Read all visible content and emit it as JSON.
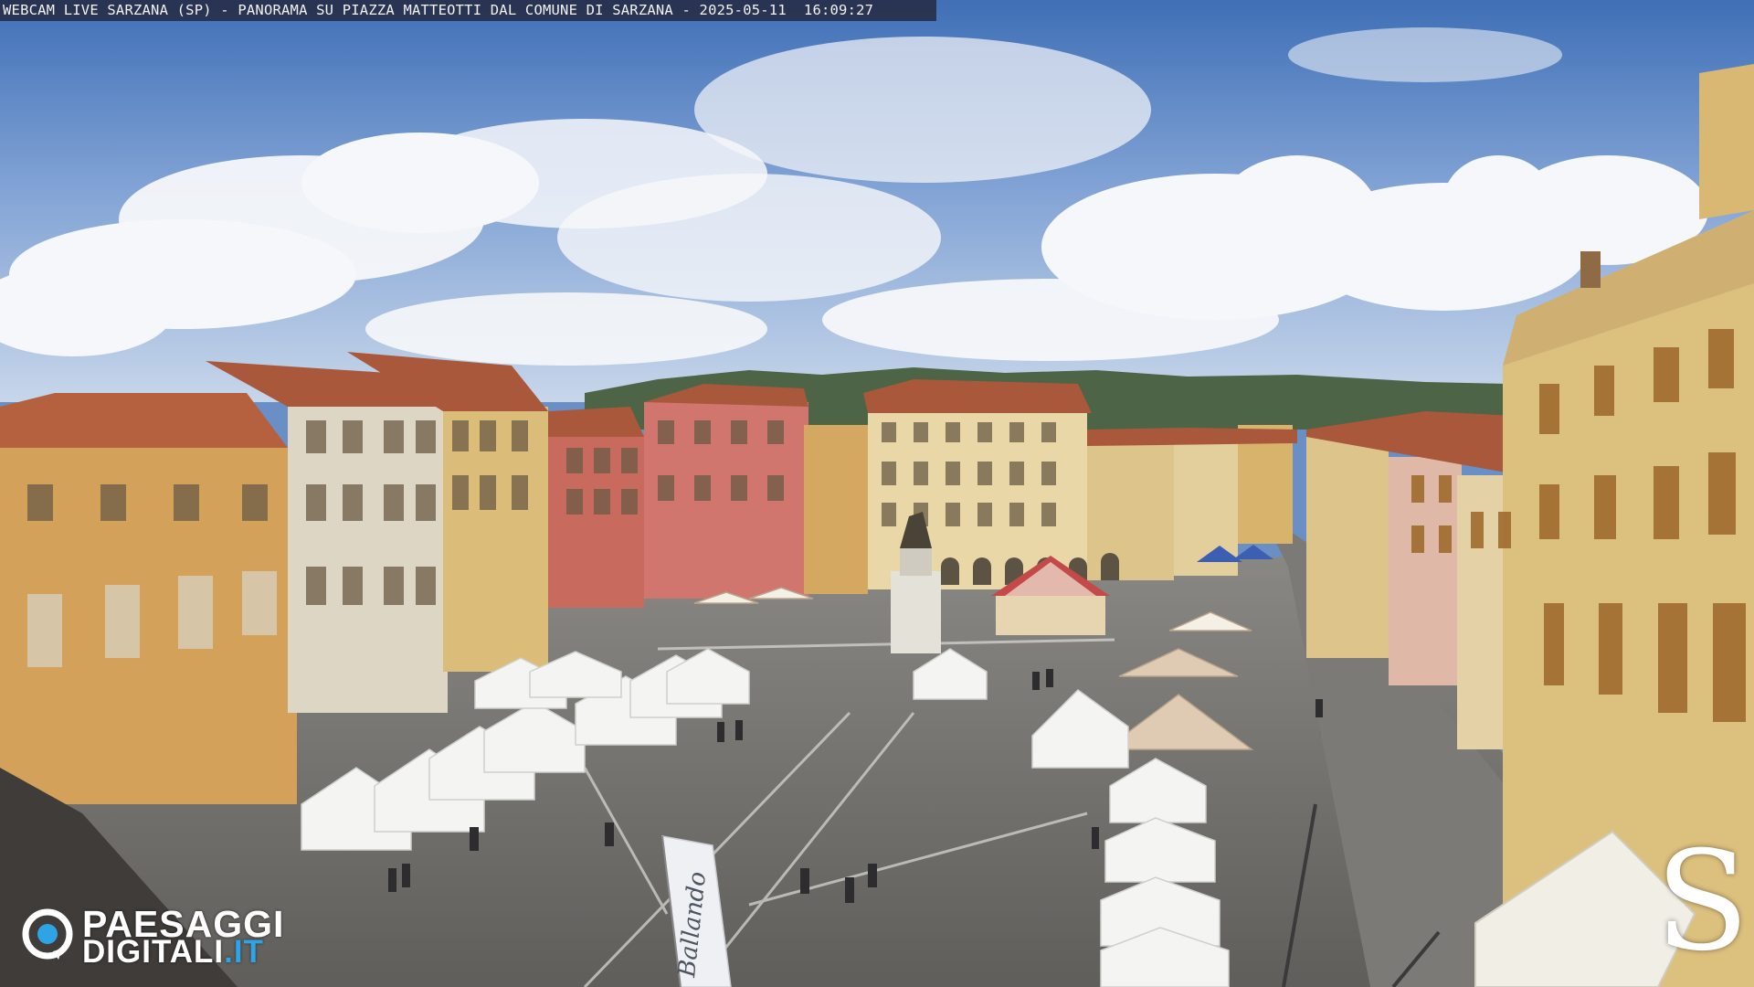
{
  "webcam": {
    "caption": "WEBCAM LIVE SARZANA (SP) - PANORAMA SU PIAZZA MATTEOTTI DAL COMUNE DI SARZANA - 2025-05-11  16:09:27"
  },
  "logo": {
    "line1": "PAESAGGI",
    "line2_main": "DIGITALI",
    "line2_accent": ".IT",
    "accent_color": "#2ea3e6"
  },
  "watermark": {
    "letter": "S"
  },
  "banner": {
    "text": "Ballando"
  },
  "colors": {
    "sky_top": "#4f7cc1",
    "sky_bottom": "#b7cce6",
    "pavement": "#6f6e6a",
    "terracotta": "#b5603f",
    "ochre": "#d3a15a",
    "pink": "#d0766e",
    "cream": "#e7d8b0"
  }
}
